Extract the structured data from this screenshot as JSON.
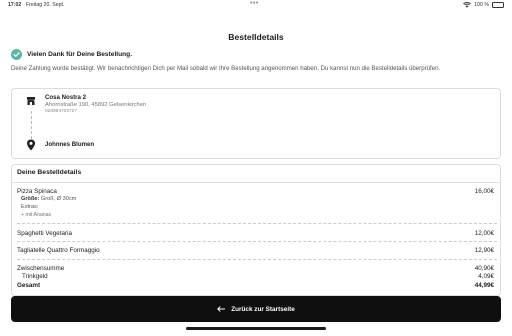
{
  "statusbar": {
    "time": "17:02",
    "date": "Freitag 20. Sept.",
    "dots": "•••",
    "battery_text": "100 %"
  },
  "page": {
    "title": "Bestelldetails"
  },
  "confirmation": {
    "thanks": "Vielen Dank für Deine Bestellung.",
    "message": "Deine Zahlung wurde bestätigt. Wir benachrichtigen Dich per Mail sobald wir Ihre Bestellung angenommen haben. Du kannst nun die Bestelldetails überprüfen."
  },
  "store": {
    "name": "Cosa Nostra 2",
    "address": "Ahornstraße 190, 45892 Gelsenkirchen",
    "phone": "020994702727"
  },
  "customer": {
    "name": "Johnnes Blumen"
  },
  "details": {
    "header": "Deine Bestelldetails",
    "items": [
      {
        "name": "Pizza Spinaca",
        "price": "16,00€",
        "size_label": "Größe:",
        "size_value": "Groß, Ø 30cm",
        "extras_label": "Extras:",
        "extras_value": "+ mit Ananas"
      },
      {
        "name": "Spaghetti Vegetaria",
        "price": "12,00€"
      },
      {
        "name": "Tagliatelle Quattro Formaggio",
        "price": "12,90€"
      }
    ],
    "subtotal_label": "Zwischensumme",
    "subtotal_value": "40,90€",
    "tip_label": "Trinkgeld",
    "tip_value": "4,09€",
    "total_label": "Gesamt",
    "total_value": "44,99€"
  },
  "actions": {
    "back_label": "Zurück zur Startseite"
  },
  "colors": {
    "accent": "#5bb5a7",
    "button": "#0f0f10"
  }
}
